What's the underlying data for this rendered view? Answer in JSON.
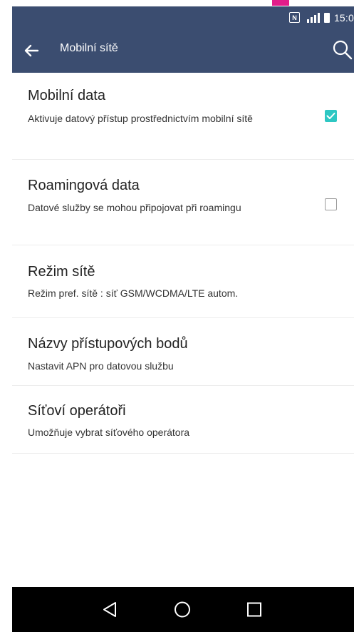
{
  "status_bar": {
    "time": "15:0",
    "icons": [
      "nfc-icon",
      "signal-icon",
      "battery-icon"
    ]
  },
  "app_bar": {
    "title": "Mobilní sítě",
    "back_icon": "arrow-left-icon",
    "search_icon": "search-icon"
  },
  "items": [
    {
      "title": "Mobilní data",
      "subtitle": "Aktivuje datový přístup prostřednictvím mobilní sítě",
      "checkbox": true
    },
    {
      "title": "Roamingová data",
      "subtitle": "Datové služby se mohou připojovat při roamingu",
      "checkbox": false
    },
    {
      "title": "Režim sítě",
      "subtitle": "Režim pref. sítě : síť GSM/WCDMA/LTE autom."
    },
    {
      "title": "Názvy přístupových bodů",
      "subtitle": "Nastavit APN pro datovou službu"
    },
    {
      "title": "Síťoví operátoři",
      "subtitle": "Umožňuje vybrat síťového operátora"
    }
  ],
  "nav_bar": {
    "buttons": [
      "back-triangle-icon",
      "home-circle-icon",
      "recents-square-icon"
    ]
  },
  "colors": {
    "app_bar": "#3b4d70",
    "checkbox_on": "#2ec7c3",
    "accent_mark": "#e21d8a"
  }
}
